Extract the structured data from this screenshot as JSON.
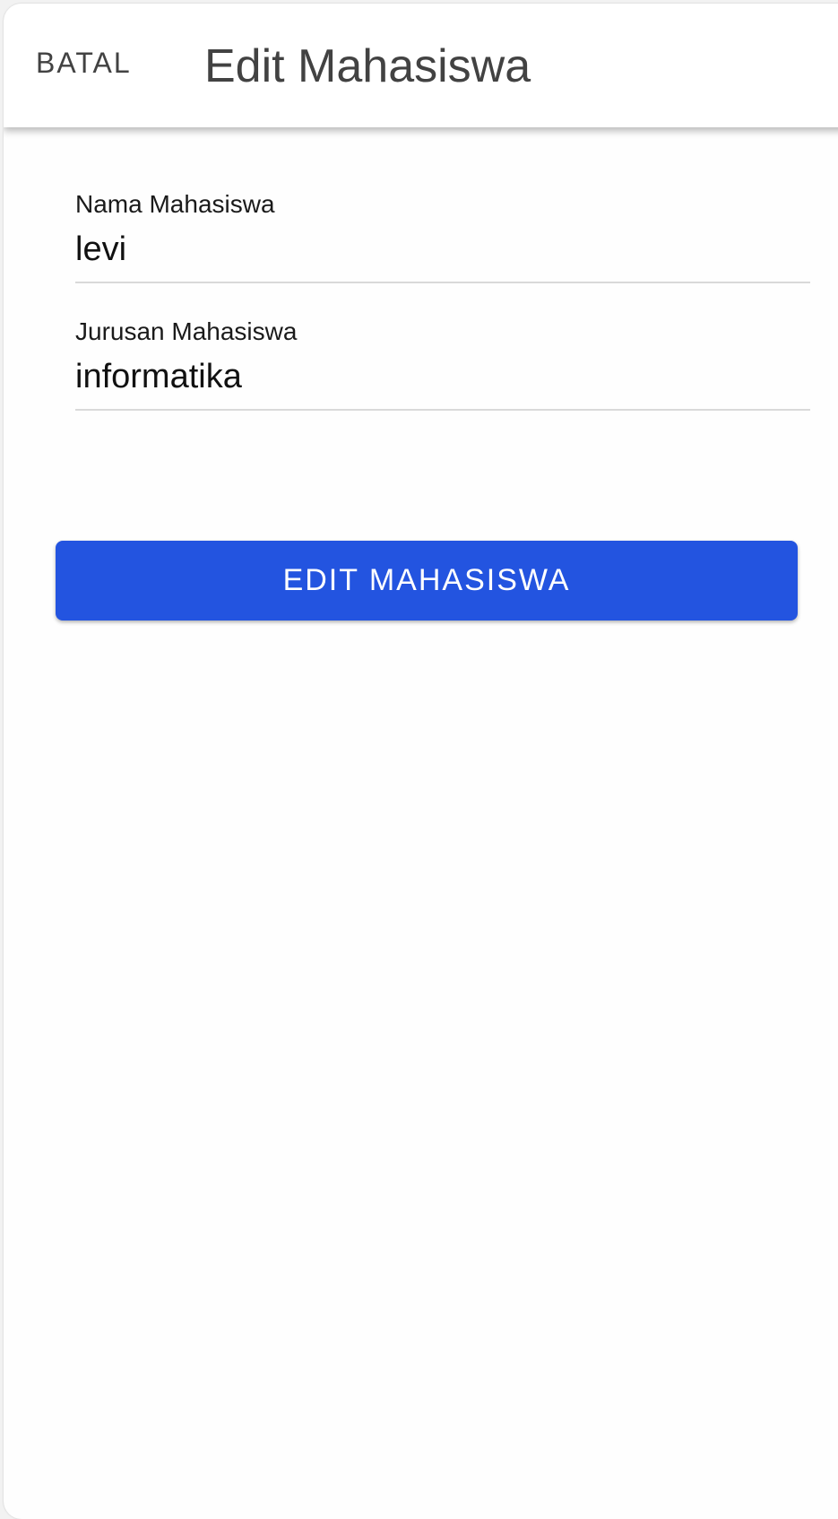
{
  "colors": {
    "primary": "#2354e0",
    "toolbar_text": "#424242",
    "background": "#fefefe"
  },
  "toolbar": {
    "cancel_label": "BATAL",
    "title": "Edit Mahasiswa"
  },
  "form": {
    "nama": {
      "label": "Nama Mahasiswa",
      "value": "levi"
    },
    "jurusan": {
      "label": "Jurusan Mahasiswa",
      "value": "informatika"
    },
    "submit_label": "EDIT MAHASISWA"
  }
}
